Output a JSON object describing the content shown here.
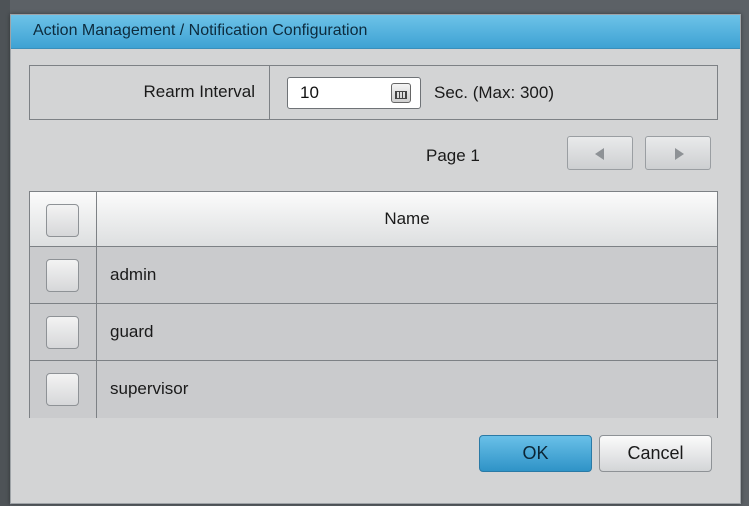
{
  "dialog": {
    "title": "Action Management / Notification Configuration"
  },
  "rearm": {
    "label": "Rearm Interval",
    "value": "10",
    "unit": "Sec. (Max: 300)",
    "icon": "keyboard-icon"
  },
  "pagination": {
    "label": "Page 1",
    "prev_icon": "left-arrow-icon",
    "next_icon": "right-arrow-icon"
  },
  "table": {
    "header": {
      "name": "Name"
    },
    "rows": [
      {
        "name": "admin"
      },
      {
        "name": "guard"
      },
      {
        "name": "supervisor"
      }
    ]
  },
  "buttons": {
    "ok": "OK",
    "cancel": "Cancel"
  },
  "colors": {
    "titlebar": "#4fb1dd",
    "ok_button": "#3ea2d3",
    "dialog_bg": "#d3d4d5"
  }
}
